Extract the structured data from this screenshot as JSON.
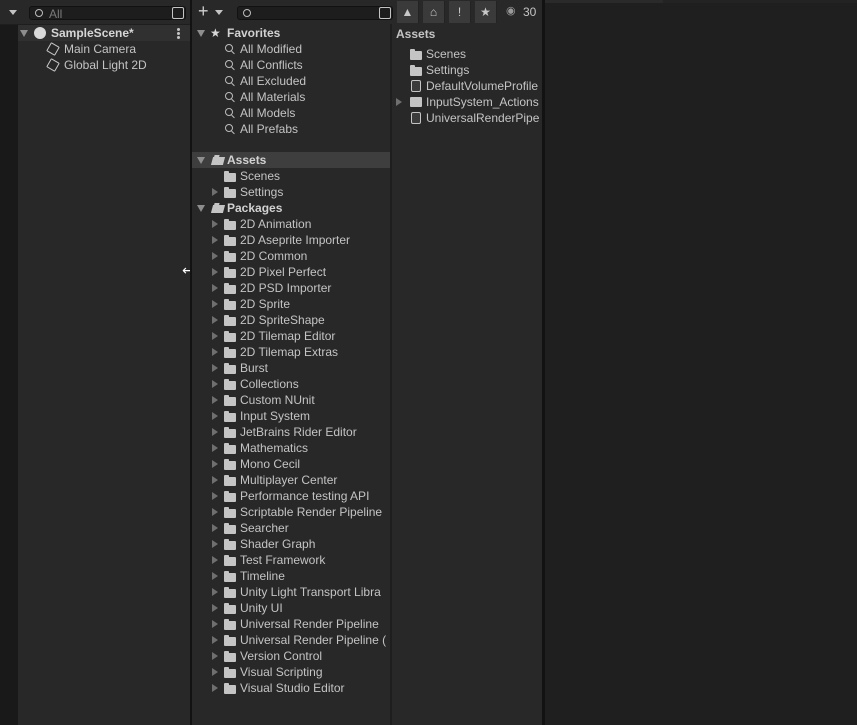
{
  "hierarchy": {
    "search_placeholder": "All",
    "scene_name": "SampleScene*",
    "objects": [
      "Main Camera",
      "Global Light 2D"
    ]
  },
  "project": {
    "add_label": "+",
    "visibility_count": "30",
    "favorites": {
      "title": "Favorites",
      "items": [
        "All Modified",
        "All Conflicts",
        "All Excluded",
        "All Materials",
        "All Models",
        "All Prefabs"
      ]
    },
    "assets_tree": {
      "title": "Assets",
      "children": [
        "Scenes",
        "Settings"
      ]
    },
    "packages": {
      "title": "Packages",
      "items": [
        "2D Animation",
        "2D Aseprite Importer",
        "2D Common",
        "2D Pixel Perfect",
        "2D PSD Importer",
        "2D Sprite",
        "2D SpriteShape",
        "2D Tilemap Editor",
        "2D Tilemap Extras",
        "Burst",
        "Collections",
        "Custom NUnit",
        "Input System",
        "JetBrains Rider Editor",
        "Mathematics",
        "Mono Cecil",
        "Multiplayer Center",
        "Performance testing API",
        "Scriptable Render Pipeline",
        "Searcher",
        "Shader Graph",
        "Test Framework",
        "Timeline",
        "Unity Light Transport Libra",
        "Unity UI",
        "Universal Render Pipeline",
        "Universal Render Pipeline (",
        "Version Control",
        "Visual Scripting",
        "Visual Studio Editor"
      ]
    },
    "grid": {
      "breadcrumb": "Assets",
      "items": [
        {
          "name": "Scenes",
          "icon": "folder-icon"
        },
        {
          "name": "Settings",
          "icon": "folder-icon"
        },
        {
          "name": "DefaultVolumeProfile",
          "icon": "volume-profile-icon"
        },
        {
          "name": "InputSystem_Actions",
          "icon": "input-actions-icon"
        },
        {
          "name": "UniversalRenderPipe",
          "icon": "render-pipeline-icon"
        }
      ]
    }
  },
  "colors": {
    "panel_bg": "#282828",
    "selected_row": "#3e3e3e",
    "text": "#c4c4c4"
  }
}
